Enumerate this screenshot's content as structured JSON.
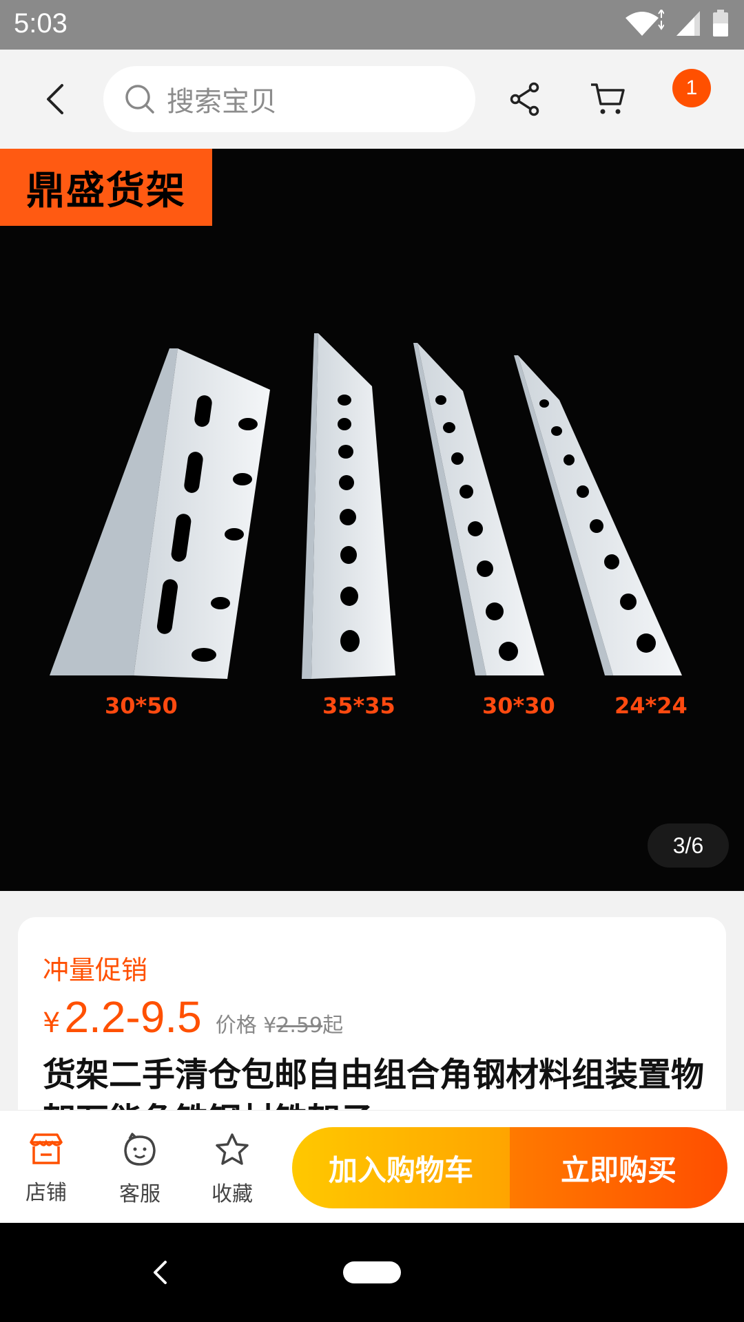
{
  "status_bar": {
    "time": "5:03"
  },
  "header": {
    "search_placeholder": "搜索宝贝",
    "cart_badge": "1",
    "icons": [
      "back-icon",
      "search-icon",
      "share-icon",
      "cart-icon",
      "more-icon"
    ]
  },
  "gallery": {
    "brand_tag": "鼎盛货架",
    "size_labels": [
      "30*50",
      "35*35",
      "30*30",
      "24*24"
    ],
    "page_indicator": "3/6"
  },
  "product": {
    "promo_label": "冲量促销",
    "price_symbol": "¥",
    "price_range": "2.2-9.5",
    "orig_price_prefix": "价格",
    "orig_price_symbol": "¥",
    "orig_price": "2.59",
    "orig_price_suffix": "起",
    "title": "货架二手清仓包邮自由组合角钢材料组装置物架万能角铁钢材铁架子"
  },
  "bottom_bar": {
    "tabs": [
      {
        "label": "店铺",
        "icon": "store-icon"
      },
      {
        "label": "客服",
        "icon": "customer-service-icon"
      },
      {
        "label": "收藏",
        "icon": "star-icon"
      }
    ],
    "add_to_cart": "加入购物车",
    "buy_now": "立即购买"
  },
  "colors": {
    "accent": "#ff5000",
    "cart_button": "#ffb400",
    "buy_button": "#ff5a00"
  }
}
